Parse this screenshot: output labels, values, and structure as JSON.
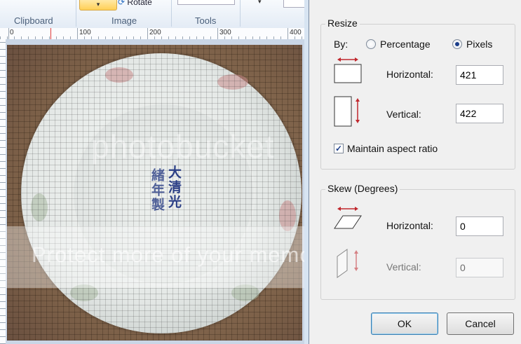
{
  "ribbon": {
    "groups": [
      "Clipboard",
      "Image",
      "Tools"
    ],
    "rotate_label": "Rotate",
    "select_dropdown": "▾",
    "tools_dropdown": "▾"
  },
  "ruler": {
    "ticks": [
      "0",
      "100",
      "200",
      "300",
      "400"
    ]
  },
  "canvas": {
    "mark_col1": "大清光",
    "mark_col2": "緒年製",
    "watermark_main": "photobucket",
    "watermark_band": "Protect more of your memories for less!"
  },
  "dialog": {
    "resize": {
      "title": "Resize",
      "by_label": "By:",
      "percentage_label": "Percentage",
      "pixels_label": "Pixels",
      "selected": "Pixels",
      "horizontal_label": "Horizontal:",
      "horizontal_value": "421",
      "vertical_label": "Vertical:",
      "vertical_value": "422",
      "maintain_label": "Maintain aspect ratio",
      "maintain_checked": true
    },
    "skew": {
      "title": "Skew (Degrees)",
      "horizontal_label": "Horizontal:",
      "horizontal_value": "0",
      "vertical_label": "Vertical:",
      "vertical_value": "0"
    },
    "ok_label": "OK",
    "cancel_label": "Cancel"
  },
  "colors": {
    "accent": "#c0272d",
    "mark_blue": "#2b3f86",
    "ribbon_select": "#ffcf56"
  }
}
